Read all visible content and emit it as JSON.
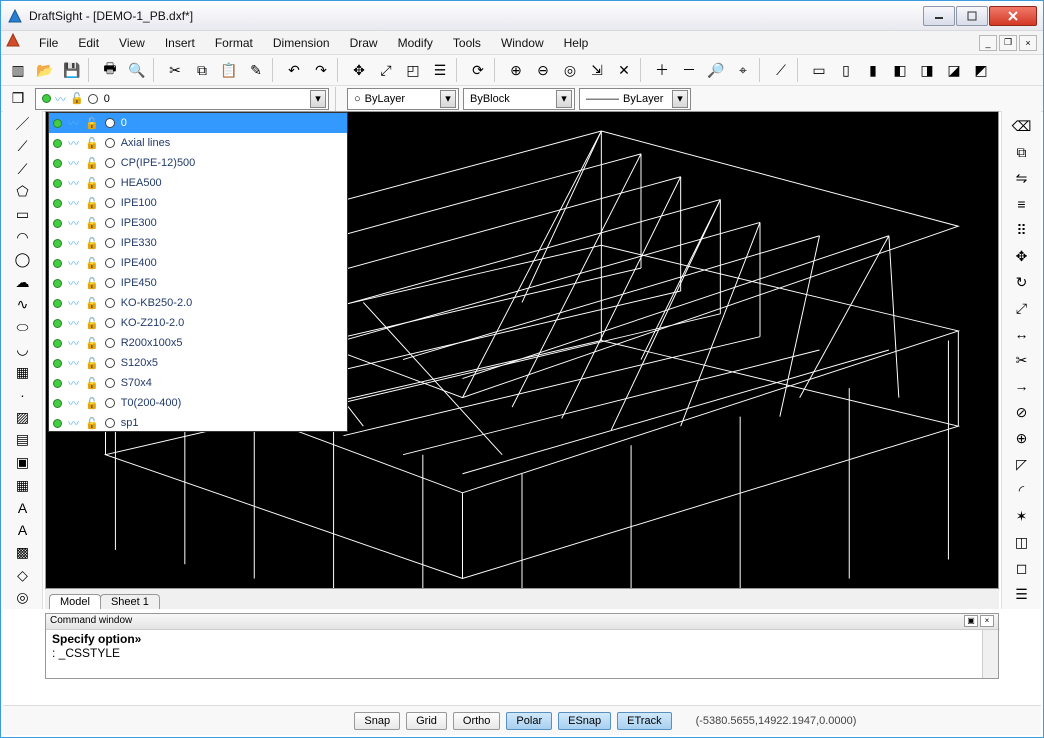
{
  "window": {
    "title": "DraftSight - [DEMO-1_PB.dxf*]"
  },
  "menu": {
    "items": [
      "File",
      "Edit",
      "View",
      "Insert",
      "Format",
      "Dimension",
      "Draw",
      "Modify",
      "Tools",
      "Window",
      "Help"
    ]
  },
  "mdi": {
    "min": "_",
    "restore": "❐",
    "close": "×"
  },
  "toolbar1": {
    "icons": [
      "new-icon",
      "open-icon",
      "save-icon",
      "print-icon",
      "zoom-icon",
      "cut-icon",
      "copy-icon",
      "paste-icon",
      "edit-icon",
      "undo-icon",
      "redo-icon",
      "pan-icon",
      "zoom-extents-icon",
      "zoom-window-icon",
      "props-icon",
      "refresh-icon",
      "zoom-in-icon",
      "zoom-out-icon",
      "zoom-all-icon",
      "zoom-range-icon",
      "zoom-x-icon",
      "zoom-plus-icon",
      "zoom-minus-icon",
      "find-icon",
      "locate-icon",
      "measure-icon",
      "view-top-icon",
      "view-front-icon",
      "view-side-icon",
      "view-iso-icon",
      "view-iso2-icon",
      "view-3d-icon",
      "view-ortho-icon"
    ]
  },
  "layerbar": {
    "manager_icon": "layers-icon",
    "current": {
      "label": "0",
      "bulb": true,
      "frozen": false,
      "locked": false
    },
    "color": {
      "label": "ByLayer",
      "swatch": "○"
    },
    "linetype": {
      "label": "ByBlock"
    },
    "lineweight": {
      "label": "ByLayer",
      "sample": "———"
    }
  },
  "layer_dropdown": {
    "items": [
      {
        "name": "0",
        "selected": true
      },
      {
        "name": "Axial lines"
      },
      {
        "name": "CP(IPE-12)500"
      },
      {
        "name": "HEA500"
      },
      {
        "name": "IPE100"
      },
      {
        "name": "IPE300"
      },
      {
        "name": "IPE330"
      },
      {
        "name": "IPE400"
      },
      {
        "name": "IPE450"
      },
      {
        "name": "KO-KB250-2.0"
      },
      {
        "name": "KO-Z210-2.0"
      },
      {
        "name": "R200x100x5"
      },
      {
        "name": "S120x5"
      },
      {
        "name": "S70x4"
      },
      {
        "name": "T0(200-400)"
      },
      {
        "name": "sp1"
      }
    ]
  },
  "left_tools": [
    "line-icon",
    "xline-icon",
    "polyline-icon",
    "polygon-icon",
    "rectangle-icon",
    "arc-icon",
    "circle-icon",
    "revcloud-icon",
    "spline-icon",
    "ellipse-icon",
    "ellipsearc-icon",
    "block-icon",
    "point-icon",
    "hatch-icon",
    "gradient-icon",
    "region-icon",
    "table-icon",
    "text-icon",
    "mtext-icon",
    "pattern-icon",
    "boundary-icon",
    "donut-icon"
  ],
  "right_tools": [
    "erase-icon",
    "copyobj-icon",
    "mirror-icon",
    "offset-icon",
    "array-icon",
    "move-icon",
    "rotate-icon",
    "scale-icon",
    "stretch-icon",
    "trim-icon",
    "extend-icon",
    "break-icon",
    "join-icon",
    "chamfer-icon",
    "fillet-icon",
    "explode-icon",
    "boxselect-icon",
    "deselect-icon",
    "properties-icon"
  ],
  "tabs": {
    "active": "Model",
    "others": [
      "Sheet 1"
    ]
  },
  "command": {
    "title": "Command window",
    "line1": "Specify option»",
    "line2": ": _CSSTYLE"
  },
  "status": {
    "buttons": [
      {
        "label": "Snap",
        "on": false
      },
      {
        "label": "Grid",
        "on": false
      },
      {
        "label": "Ortho",
        "on": false
      },
      {
        "label": "Polar",
        "on": true
      },
      {
        "label": "ESnap",
        "on": true
      },
      {
        "label": "ETrack",
        "on": true
      }
    ],
    "coords": "(-5380.5655,14922.1947,0.0000)"
  }
}
